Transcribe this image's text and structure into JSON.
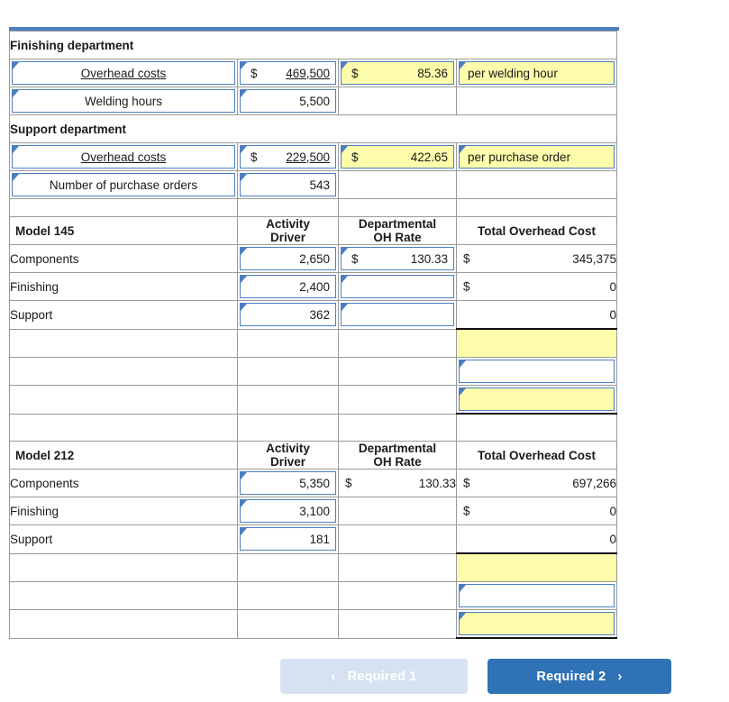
{
  "accent": {
    "header_blue": "#76aae4",
    "input_border_blue": "#4c7fc0",
    "input_yellow": "#fdfcab",
    "button_blue": "#2f72b5",
    "button_disabled": "#d6e2f2"
  },
  "rate_section": {
    "departments": [
      {
        "title": "Finishing department",
        "rows": [
          {
            "label": "Overhead costs",
            "label_underlined": true,
            "amount_currency": "$",
            "amount": "469,500",
            "amount_underlined": true,
            "rate_currency": "$",
            "rate": "85.36",
            "rate_unit": "per welding hour"
          },
          {
            "label": "Welding hours",
            "label_underlined": false,
            "amount_currency": "",
            "amount": "5,500",
            "amount_underlined": false,
            "rate_currency": "",
            "rate": "",
            "rate_unit": ""
          }
        ]
      },
      {
        "title": "Support department",
        "rows": [
          {
            "label": "Overhead costs",
            "label_underlined": true,
            "amount_currency": "$",
            "amount": "229,500",
            "amount_underlined": true,
            "rate_currency": "$",
            "rate": "422.65",
            "rate_unit": "per purchase order"
          },
          {
            "label": "Number of purchase orders",
            "label_underlined": false,
            "amount_currency": "",
            "amount": "543",
            "amount_underlined": false,
            "rate_currency": "",
            "rate": "",
            "rate_unit": ""
          }
        ]
      }
    ]
  },
  "models": [
    {
      "name": "Model 145",
      "columns": {
        "driver": "Activity\nDriver",
        "driver_line1": "Activity",
        "driver_line2": "Driver",
        "rate_line1": "Departmental",
        "rate_line2": "OH Rate",
        "total": "Total Overhead Cost"
      },
      "rows": [
        {
          "label": "Components",
          "driver": "2,650",
          "rate_currency": "$",
          "rate": "130.33",
          "total_currency": "$",
          "total": "345,375"
        },
        {
          "label": "Finishing",
          "driver": "2,400",
          "rate_currency": "",
          "rate": "",
          "total_currency": "$",
          "total": "0"
        },
        {
          "label": "Support",
          "driver": "362",
          "rate_currency": "",
          "rate": "",
          "total_currency": "",
          "total": "0"
        }
      ],
      "blank_rows": [
        {
          "label": "",
          "total": "",
          "style": "yellow-plain"
        },
        {
          "label": "",
          "total": "",
          "style": "white-input"
        },
        {
          "label": "",
          "total": "",
          "style": "yellow-input"
        }
      ]
    },
    {
      "name": "Model 212",
      "columns": {
        "driver_line1": "Activity",
        "driver_line2": "Driver",
        "rate_line1": "Departmental",
        "rate_line2": "OH Rate",
        "total": "Total Overhead Cost"
      },
      "rows": [
        {
          "label": "Components",
          "driver": "5,350",
          "rate_currency": "$",
          "rate": "130.33",
          "total_currency": "$",
          "total": "697,266"
        },
        {
          "label": "Finishing",
          "driver": "3,100",
          "rate_currency": "",
          "rate": "",
          "total_currency": "$",
          "total": "0"
        },
        {
          "label": "Support",
          "driver": "181",
          "rate_currency": "",
          "rate": "",
          "total_currency": "",
          "total": "0"
        }
      ],
      "blank_rows": [
        {
          "label": "",
          "total": "",
          "style": "yellow-plain"
        },
        {
          "label": "",
          "total": "",
          "style": "white-input"
        },
        {
          "label": "",
          "total": "",
          "style": "yellow-input"
        }
      ]
    }
  ],
  "footer": {
    "prev_label": "Required 1",
    "prev_icon": "chevron-left-icon",
    "prev_glyph": "‹",
    "next_label": "Required 2",
    "next_icon": "chevron-right-icon",
    "next_glyph": "›"
  }
}
